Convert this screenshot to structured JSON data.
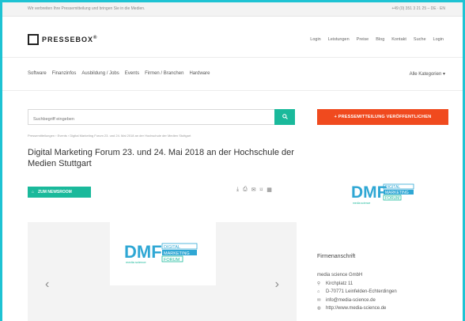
{
  "topbar": {
    "left": "Wir verbreiten Ihre Pressemitteilung und bringen Sie in die Medien.",
    "right": "+49 (0) 351 3 21 25 – DE · EN"
  },
  "header": {
    "logo": "PRESSEBOX",
    "logo_mark": "®",
    "nav": [
      "Login",
      "Leistungen",
      "Preise",
      "Blog",
      "Kontakt",
      "Suche",
      "Login"
    ]
  },
  "catnav": {
    "items": [
      "Software",
      "Finanzinfos",
      "Ausbildung / Jobs",
      "Events",
      "Firmen / Branchen",
      "Hardware"
    ],
    "all": "Alle Kategorien"
  },
  "search": {
    "placeholder": "Suchbegriff eingeben"
  },
  "publish_button": "PRESSEMITTEILUNG VERÖFFENTLICHEN",
  "breadcrumb": "Pressemitteilungen › Events › Digital Marketing Forum 23. und 24. Mai 2018 an der Hochschule der Medien Stuttgart",
  "title": "Digital Marketing Forum 23. und 24. Mai 2018 an der Hochschule der Medien Stuttgart",
  "newsroom_button": "ZUM NEWSROOM",
  "brand": {
    "dmf_big": "DMF",
    "dmf_line1": "DIGITAL",
    "dmf_line2": "MARKETING",
    "dmf_line3": "FORUM",
    "dmf_tagline": "media science"
  },
  "company": {
    "heading": "Firmenanschrift",
    "name": "media science GmbH",
    "street": "Kirchplatz 11",
    "city": "D-70771 Leinfelden-Echterdingen",
    "email": "info@media-science.de",
    "web": "http://www.media-science.de"
  },
  "colors": {
    "accent": "#1ab99b",
    "orange": "#f04a1e",
    "frame": "#1ec3d3"
  }
}
